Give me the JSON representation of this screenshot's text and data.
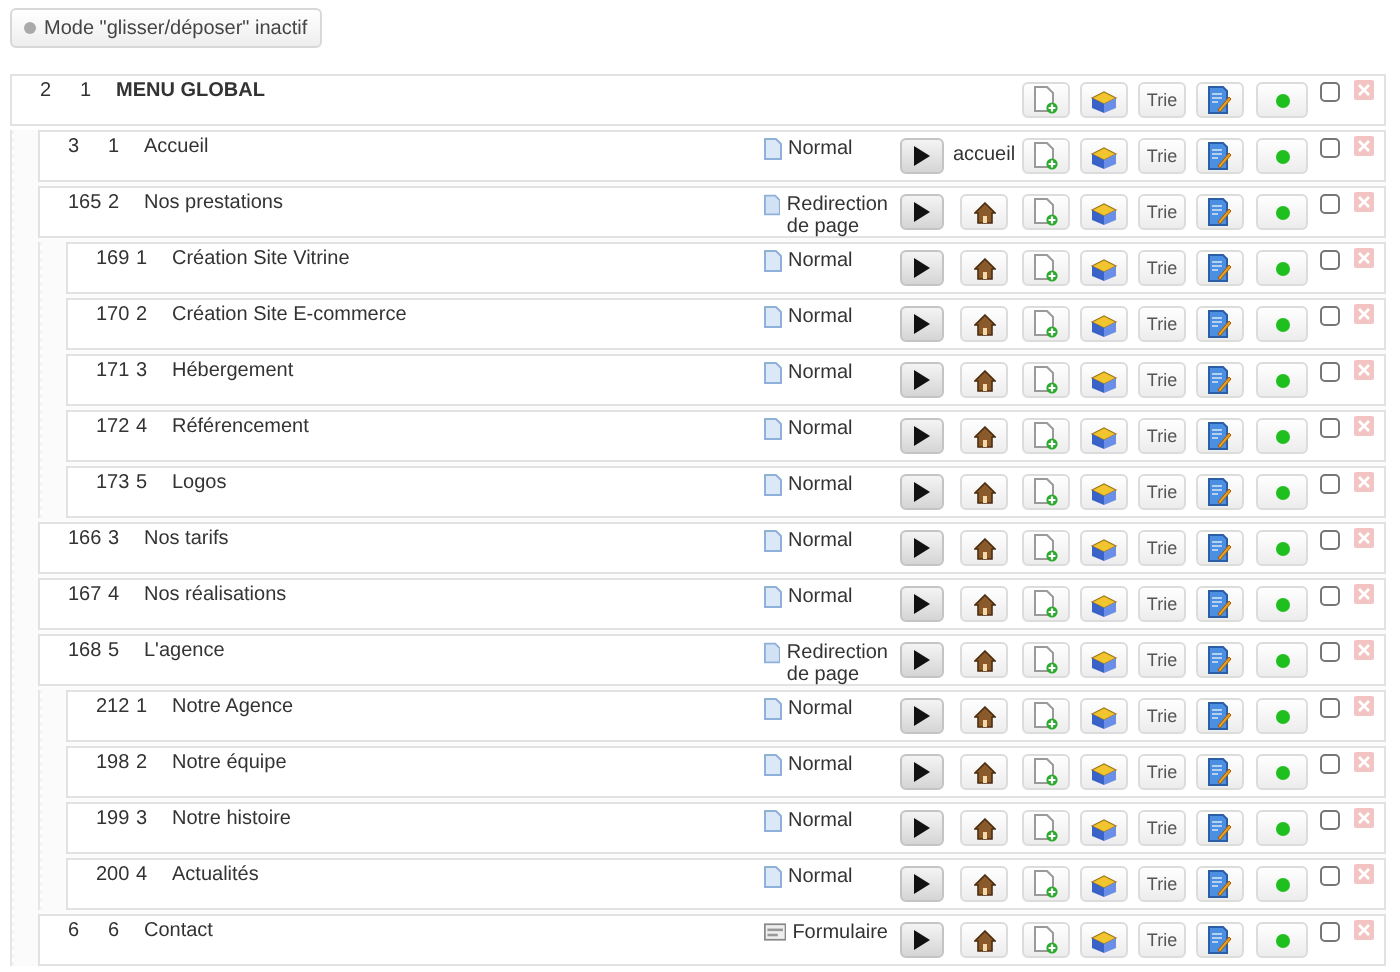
{
  "mode_button": {
    "label": "Mode \"glisser/déposer\" inactif",
    "active": false
  },
  "menu": {
    "id": "2",
    "order": "1",
    "title": "MENU GLOBAL",
    "trie": "Trie",
    "active": true,
    "checked": false,
    "children": [
      {
        "id": "3",
        "order": "1",
        "title": "Accueil",
        "page_type": {
          "kind": "normal",
          "label": "Normal"
        },
        "home": {
          "kind": "label",
          "text": "accueil"
        },
        "trie": "Trie",
        "active": true,
        "checked": false
      },
      {
        "id": "165",
        "order": "2",
        "title": "Nos prestations",
        "page_type": {
          "kind": "redirect",
          "label": "Redirection de page"
        },
        "home": {
          "kind": "button"
        },
        "trie": "Trie",
        "active": true,
        "checked": false,
        "children": [
          {
            "id": "169",
            "order": "1",
            "title": "Création Site Vitrine",
            "page_type": {
              "kind": "normal",
              "label": "Normal"
            },
            "home": {
              "kind": "button"
            },
            "trie": "Trie",
            "active": true,
            "checked": false
          },
          {
            "id": "170",
            "order": "2",
            "title": "Création Site E-commerce",
            "page_type": {
              "kind": "normal",
              "label": "Normal"
            },
            "home": {
              "kind": "button"
            },
            "trie": "Trie",
            "active": true,
            "checked": false
          },
          {
            "id": "171",
            "order": "3",
            "title": "Hébergement",
            "page_type": {
              "kind": "normal",
              "label": "Normal"
            },
            "home": {
              "kind": "button"
            },
            "trie": "Trie",
            "active": true,
            "checked": false
          },
          {
            "id": "172",
            "order": "4",
            "title": "Référencement",
            "page_type": {
              "kind": "normal",
              "label": "Normal"
            },
            "home": {
              "kind": "button"
            },
            "trie": "Trie",
            "active": true,
            "checked": false
          },
          {
            "id": "173",
            "order": "5",
            "title": "Logos",
            "page_type": {
              "kind": "normal",
              "label": "Normal"
            },
            "home": {
              "kind": "button"
            },
            "trie": "Trie",
            "active": true,
            "checked": false
          }
        ]
      },
      {
        "id": "166",
        "order": "3",
        "title": "Nos tarifs",
        "page_type": {
          "kind": "normal",
          "label": "Normal"
        },
        "home": {
          "kind": "button"
        },
        "trie": "Trie",
        "active": true,
        "checked": false
      },
      {
        "id": "167",
        "order": "4",
        "title": "Nos réalisations",
        "page_type": {
          "kind": "normal",
          "label": "Normal"
        },
        "home": {
          "kind": "button"
        },
        "trie": "Trie",
        "active": true,
        "checked": false
      },
      {
        "id": "168",
        "order": "5",
        "title": "L'agence",
        "page_type": {
          "kind": "redirect",
          "label": "Redirection de page"
        },
        "home": {
          "kind": "button"
        },
        "trie": "Trie",
        "active": true,
        "checked": false,
        "children": [
          {
            "id": "212",
            "order": "1",
            "title": "Notre Agence",
            "page_type": {
              "kind": "normal",
              "label": "Normal"
            },
            "home": {
              "kind": "button"
            },
            "trie": "Trie",
            "active": true,
            "checked": false
          },
          {
            "id": "198",
            "order": "2",
            "title": "Notre équipe",
            "page_type": {
              "kind": "normal",
              "label": "Normal"
            },
            "home": {
              "kind": "button"
            },
            "trie": "Trie",
            "active": true,
            "checked": false
          },
          {
            "id": "199",
            "order": "3",
            "title": "Notre histoire",
            "page_type": {
              "kind": "normal",
              "label": "Normal"
            },
            "home": {
              "kind": "button"
            },
            "trie": "Trie",
            "active": true,
            "checked": false
          },
          {
            "id": "200",
            "order": "4",
            "title": "Actualités",
            "page_type": {
              "kind": "normal",
              "label": "Normal"
            },
            "home": {
              "kind": "button"
            },
            "trie": "Trie",
            "active": true,
            "checked": false
          }
        ]
      },
      {
        "id": "6",
        "order": "6",
        "title": "Contact",
        "page_type": {
          "kind": "form",
          "label": "Formulaire"
        },
        "home": {
          "kind": "button"
        },
        "trie": "Trie",
        "active": true,
        "checked": false
      }
    ]
  }
}
